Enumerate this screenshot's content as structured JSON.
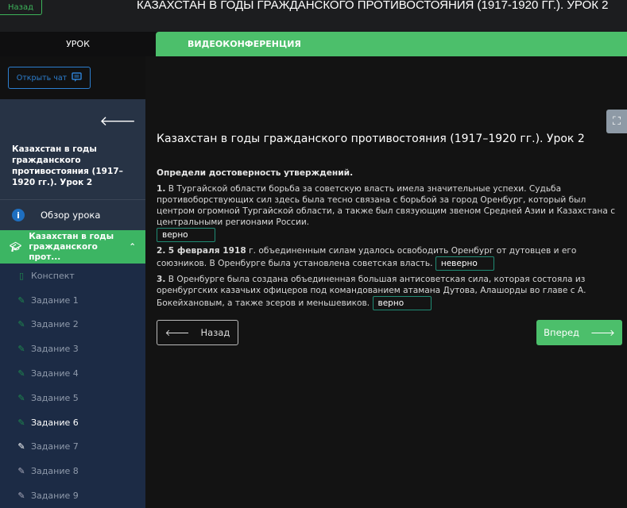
{
  "header": {
    "back_label": "Назад",
    "title": "КАЗАХСТАН В ГОДЫ ГРАЖДАНСКОГО ПРОТИВОСТОЯНИЯ (1917-1920 ГГ.). УРОК 2"
  },
  "tabs": [
    {
      "label": "УРОК"
    },
    {
      "label": "ВИДЕОКОНФЕРЕНЦИЯ"
    }
  ],
  "chat_button": "Открыть чат",
  "sidebar": {
    "title": "Казахстан в годы гражданского противостояния (1917–1920 гг.). Урок 2",
    "overview": "Обзор урока",
    "active_section": "Казахстан в годы гражданского прот...",
    "items": [
      {
        "label": "Конспект",
        "status": "notes"
      },
      {
        "label": "Задание 1",
        "status": "done"
      },
      {
        "label": "Задание 2",
        "status": "done"
      },
      {
        "label": "Задание 3",
        "status": "done"
      },
      {
        "label": "Задание 4",
        "status": "done"
      },
      {
        "label": "Задание 5",
        "status": "done"
      },
      {
        "label": "Задание 6",
        "status": "current"
      },
      {
        "label": "Задание 7",
        "status": "todo"
      },
      {
        "label": "Задание 8",
        "status": "todo"
      },
      {
        "label": "Задание 9",
        "status": "todo"
      }
    ]
  },
  "main": {
    "title": "Казахстан в годы гражданского противостояния (1917–1920 гг.). Урок 2",
    "question": "Определи достоверность утверждений.",
    "statements": [
      {
        "num": "1.",
        "text": "В Тургайской области борьба за советскую власть имела значительные успехи. Судьба противоборствующих сил здесь была тесно связана с борьбой за город Оренбург, который был центром огромной Тургайской области, а также был связующим звеном Средней Азии и Казахстана с центральными регионами России.",
        "answer": "верно"
      },
      {
        "num": "2.",
        "text_pre": "5 февраля 1918",
        "text": "г. объединенным силам удалось освободить Оренбург от дутовцев и его союзников. В Оренбурге была установлена советская власть.",
        "answer": "неверно"
      },
      {
        "num": "3.",
        "text": "В Оренбурге была создана объединенная большая антисоветская сила, которая состояла из оренбургских казачьих офицеров под командованием атамана Дутова, Алашорды во главе с А. Бокейхановым, а также эсеров и меньшевиков.",
        "answer": "верно"
      }
    ],
    "back_label": "Назад",
    "next_label": "Вперед"
  },
  "colors": {
    "accent": "#4cbf6b",
    "sidebar": "#1c2b45",
    "chat": "#2d7fd0"
  }
}
